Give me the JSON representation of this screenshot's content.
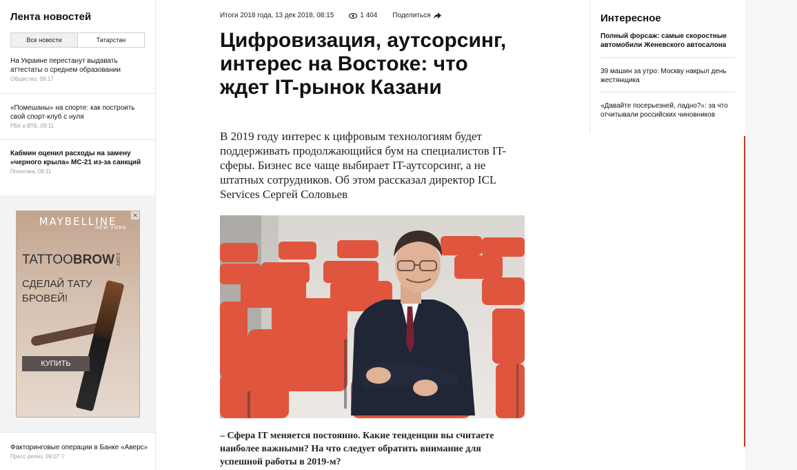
{
  "left": {
    "title": "Лента новостей",
    "tabs": [
      "Все новости",
      "Татарстан"
    ],
    "news": [
      {
        "title": "На Украине перестанут выдавать аттестаты о среднем образовании",
        "meta": "Общество, 09:17",
        "bold": false
      },
      {
        "title": "«Помешаны» на спорте: как построить свой спорт-клуб с нуля",
        "meta": "РБК и ВТБ, 09:11",
        "bold": false
      },
      {
        "title": "Кабмин оценил расходы на замену «черного крыла» МС-21 из-за санкций",
        "meta": "Политика, 09:11",
        "bold": true
      }
    ],
    "bottom": {
      "title": "Факторинговые операции в Банке «Аверс»",
      "meta": "Пресс-релиз, 09:07"
    }
  },
  "ad": {
    "brand": "MAYBELLINE",
    "sub": "NEW YORK",
    "tattoo": "TATTOO",
    "brow": "BROW",
    "days": "3 DAY",
    "headline": "СДЕЛАЙ ТАТУ БРОВЕЙ!",
    "button": "КУПИТЬ",
    "close": "✕"
  },
  "article": {
    "section_date": "Итоги 2018 года, 13 дек 2018, 08:15",
    "views": "1 404",
    "share": "Поделиться",
    "title": "Цифровизация, аутсорсинг, интерес на Востоке: что ждет IT-рынок Казани",
    "lead": "В 2019 году интерес к цифровым технологиям будет поддерживать продолжающийся бум на специалистов IT-сферы. Бизнес все чаще выбирает IT-аутсорсинг, а не штатных сотрудников. Об этом рассказал директор ICL Services Сергей Соловьев",
    "question": "– Сфера IT меняется постоянно. Какие тенденции вы считаете наиболее важными? На что следует обратить внимание для успешной работы в 2019-м?"
  },
  "right": {
    "title": "Интересное",
    "news": [
      {
        "title": "Полный форсаж: самые скоростные автомобили Женевского автосалона",
        "bold": true
      },
      {
        "title": "39 машин за утро: Москву накрыл день жестянщика",
        "bold": false
      },
      {
        "title": "«Давайте посерьезней, ладно?»: за что отчитывали российских чиновников",
        "bold": false
      }
    ]
  }
}
